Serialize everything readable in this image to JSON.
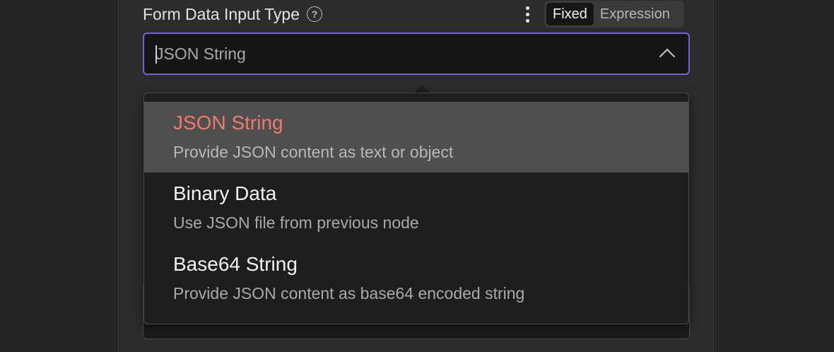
{
  "parameter": {
    "label": "Form Data Input Type",
    "mode_fixed": "Fixed",
    "mode_expression": "Expression"
  },
  "select": {
    "value": "JSON String",
    "options": [
      {
        "title": "JSON String",
        "description": "Provide JSON content as text or object",
        "selected": true
      },
      {
        "title": "Binary Data",
        "description": "Use JSON file from previous node",
        "selected": false
      },
      {
        "title": "Base64 String",
        "description": "Provide JSON content as base64 encoded string",
        "selected": false
      }
    ]
  },
  "colors": {
    "accent_border": "#7262d8",
    "selected_title": "#f07b68",
    "selected_bg": "#4f4f4f"
  },
  "icons": {
    "help": "question-circle-icon",
    "options": "vertical-dots-icon",
    "chevron": "chevron-up-icon"
  }
}
